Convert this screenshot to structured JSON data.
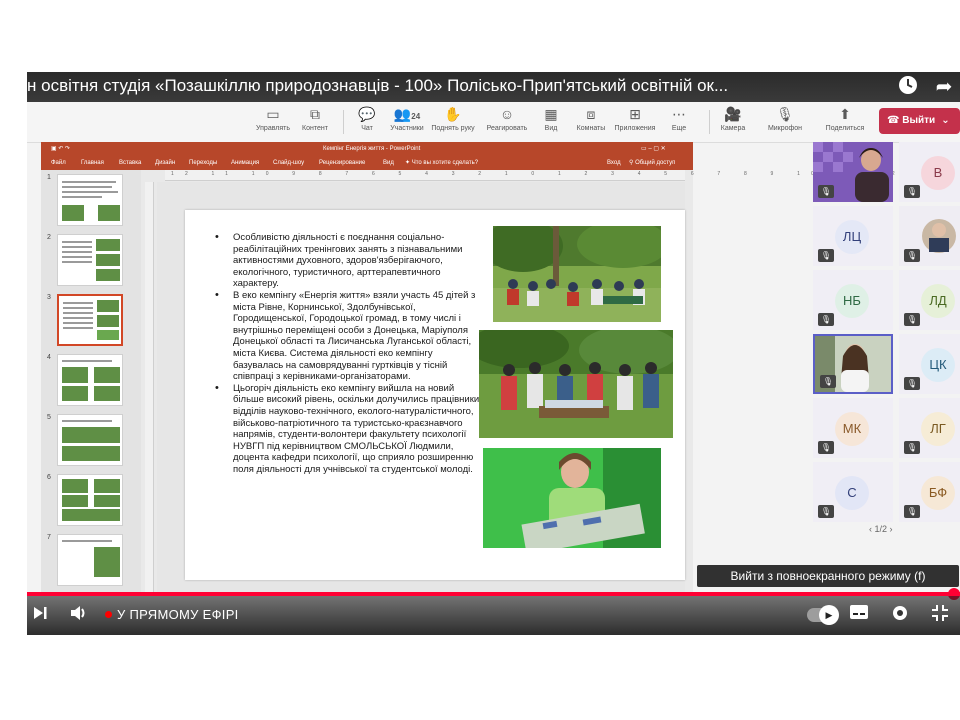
{
  "youtube": {
    "video_title": "н освітня студія «Позашкіллю природознавців - 100» Полісько-Прип'ятський освітній ок...",
    "live_label": "У ПРЯМОМУ ЕФІРІ",
    "tooltip": "Вийти з повноекранного режиму (f)",
    "progress_fraction": 1.0
  },
  "teams_toolbar": {
    "items": [
      {
        "label": "Управлять",
        "icon": "▭"
      },
      {
        "label": "Контент",
        "icon": "⧉"
      },
      {
        "label": "Чат",
        "icon": "💬"
      },
      {
        "label": "Участники",
        "icon": "👥",
        "count": "24"
      },
      {
        "label": "Поднять руку",
        "icon": "✋"
      },
      {
        "label": "Реагировать",
        "icon": "☺"
      },
      {
        "label": "Вид",
        "icon": "▦"
      },
      {
        "label": "Комнаты",
        "icon": "⧈"
      },
      {
        "label": "Приложения",
        "icon": "⊞"
      },
      {
        "label": "Еще",
        "icon": "⋯"
      },
      {
        "label": "Камера",
        "icon": "🎥"
      },
      {
        "label": "Микрофон",
        "icon": "🎙"
      },
      {
        "label": "Поделиться",
        "icon": "⬆"
      }
    ],
    "leave_label": "Выйти"
  },
  "powerpoint": {
    "window_title": "Кемпінг Енергія життя - PowerPoint",
    "ribbon_tabs": [
      "Файл",
      "Главная",
      "Вставка",
      "Дизайн",
      "Переходы",
      "Анимация",
      "Слайд-шоу",
      "Рецензирование",
      "Вид"
    ],
    "tell_me": "Что вы хотите сделать?",
    "sign_in": "Вход",
    "share": "Общий доступ",
    "ruler_marks": [
      "12",
      "11",
      "10",
      "9",
      "8",
      "7",
      "6",
      "5",
      "4",
      "3",
      "2",
      "1",
      "0",
      "1",
      "2",
      "3",
      "4",
      "5",
      "6",
      "7",
      "8",
      "9",
      "10",
      "11",
      "12"
    ],
    "slide_numbers": [
      "1",
      "2",
      "3",
      "4",
      "5",
      "6",
      "7"
    ],
    "active_slide": 3,
    "bullets": [
      "Особливістю діяльності є поєднання соціально-реабілітаційних тренінгових занять з пізнавальними активностями духовного, здоров'язберігаючого, екологічного, туристичного, арттерапевтичного характеру.",
      "В еко кемпінгу «Енергія життя» взяли участь 45 дітей з міста Рівне, Корнинської, Здолбунівської, Городищенської, Городоцької громад, в тому числі і внутрішньо переміщені особи з Донецька, Маріуполя Донецької області та Лисичанська Луганської області, міста Києва. Система діяльності еко кемпінгу базувалась на самоврядуванні гуртківців у тісній співпраці з керівниками-організаторами.",
      "Цьогоріч діяльність еко кемпінгу вийшла на новий більше високий рівень, оскільки долучились працівники відділів науково-технічного, еколого-натуралістичного, військово-патріотичного та туристсько-краєзнавчого напрямів, студенти-волонтери факультету психології НУВГП під керівництвом СМОЛЬСЬКОЇ Людмили, доцента кафедри психології, що сприяло розширенню поля діяльності для учнівської та студентської молоді."
    ]
  },
  "participants": {
    "tiles": [
      {
        "initials": "",
        "type": "video"
      },
      {
        "initials": "В",
        "type": "avatar"
      },
      {
        "initials": "ЛЦ",
        "type": "avatar"
      },
      {
        "initials": "",
        "type": "photo"
      },
      {
        "initials": "НБ",
        "type": "avatar"
      },
      {
        "initials": "ЛД",
        "type": "avatar"
      },
      {
        "initials": "",
        "type": "video"
      },
      {
        "initials": "ЦК",
        "type": "avatar"
      },
      {
        "initials": "МК",
        "type": "avatar"
      },
      {
        "initials": "ЛГ",
        "type": "avatar"
      },
      {
        "initials": "С",
        "type": "avatar"
      },
      {
        "initials": "БФ",
        "type": "avatar"
      }
    ],
    "page_indicator": "1/2"
  }
}
